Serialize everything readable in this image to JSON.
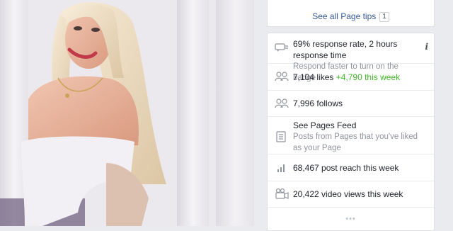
{
  "tips": {
    "link": "See all Page tips",
    "badge": "1"
  },
  "stats": {
    "response": {
      "title": "69% response rate, 2 hours response time",
      "sub": "Respond faster to turn on the badge",
      "info_icon": "i"
    },
    "likes": {
      "count": "7,104 likes",
      "delta": "+4,790 this week"
    },
    "follows": {
      "count": "7,996 follows"
    },
    "feed": {
      "title": "See Pages Feed",
      "sub": "Posts from Pages that you've liked as your Page"
    },
    "reach": {
      "text": "68,467 post reach this week"
    },
    "views": {
      "text": "20,422 video views this week"
    },
    "more": "•••"
  },
  "colors": {
    "link": "#365899",
    "green": "#42b72a",
    "muted": "#90949c",
    "border": "#dddfe2",
    "page_bg": "#e9ebee"
  }
}
